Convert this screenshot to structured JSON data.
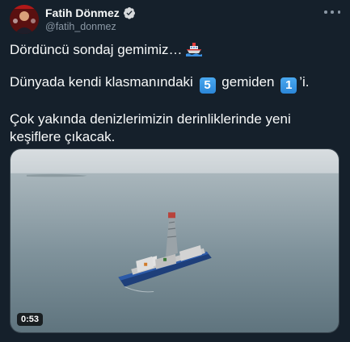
{
  "user": {
    "display_name": "Fatih Dönmez",
    "handle": "@fatih_donmez"
  },
  "tweet": {
    "line1": "Dördüncü sondaj gemimiz…",
    "line2_before": "Dünyada kendi klasmanındaki",
    "keycap_1": "5",
    "line2_middle": "gemiden",
    "keycap_2": "1",
    "line2_after": "’i.",
    "line3": "Çok yakında denizlerimizin derinliklerinde yeni keşiflere çıkacak."
  },
  "media": {
    "duration": "0:53"
  },
  "icons": {
    "ship": "ship-emoji-icon",
    "verified": "verified-badge-icon",
    "more": "more-options-icon"
  },
  "colors": {
    "background": "#15202b",
    "text": "#f7f9f9",
    "secondary_text": "#8b98a5",
    "verified": "#1d9bf0"
  }
}
